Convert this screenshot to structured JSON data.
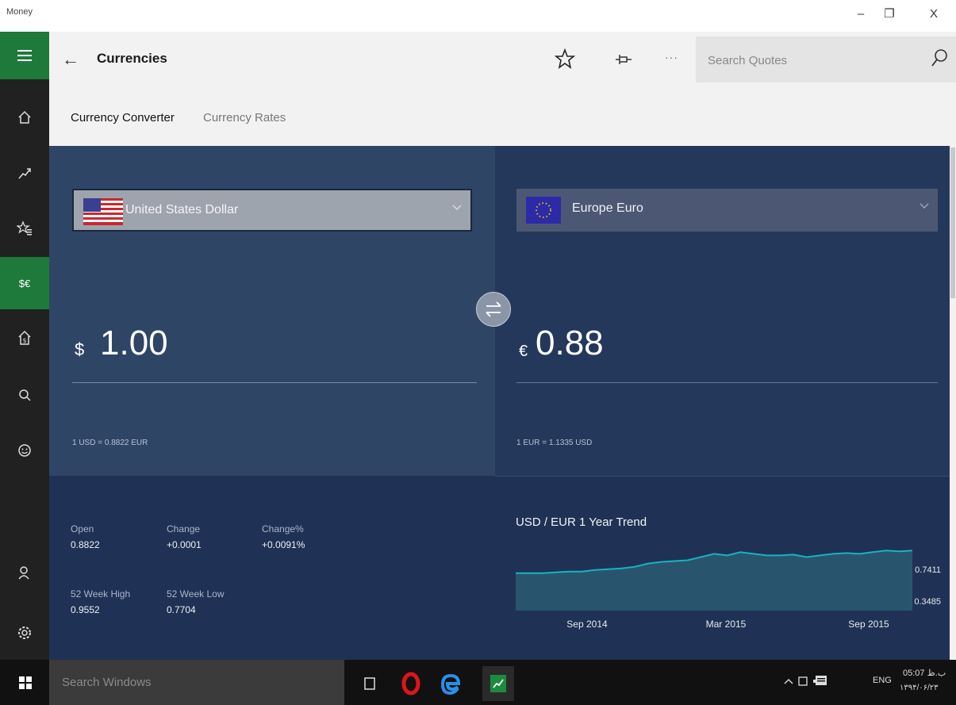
{
  "window": {
    "app_title": "Money",
    "minimize_glyph": "–",
    "maximize_glyph": "❐",
    "close_glyph": "X"
  },
  "nav": {
    "items": [
      {
        "name": "menu-icon",
        "active": true
      },
      {
        "name": "home-icon"
      },
      {
        "name": "market-trend-icon"
      },
      {
        "name": "watchlist-icon"
      },
      {
        "name": "currency-icon",
        "label": "$€",
        "active": true
      },
      {
        "name": "mortgage-calculator-icon"
      },
      {
        "name": "world-markets-icon"
      },
      {
        "name": "news-icon"
      },
      {
        "name": "account-icon"
      },
      {
        "name": "settings-icon"
      }
    ]
  },
  "header": {
    "back_glyph": "←",
    "title": "Currencies",
    "more_glyph": "···",
    "search_placeholder": "Search Quotes"
  },
  "tabs": [
    {
      "label": "Currency Converter",
      "active": true
    },
    {
      "label": "Currency Rates",
      "active": false
    }
  ],
  "converter": {
    "from": {
      "currency": "United States Dollar",
      "symbol": "$",
      "amount": "1.00",
      "rate": "1 USD = 0.8822 EUR"
    },
    "to": {
      "currency": "Europe Euro",
      "symbol": "€",
      "amount": "0.88",
      "rate": "1 EUR = 1.1335 USD"
    }
  },
  "stats": {
    "open": {
      "label": "Open",
      "value": "0.8822"
    },
    "change": {
      "label": "Change",
      "value": "+0.0001"
    },
    "change_pct": {
      "label": "Change%",
      "value": "+0.0091%"
    },
    "week52_high": {
      "label": "52 Week High",
      "value": "0.9552"
    },
    "week52_low": {
      "label": "52 Week Low",
      "value": "0.7704"
    }
  },
  "chart_data": {
    "type": "area",
    "title": "USD / EUR  1 Year Trend",
    "x_tick_labels": [
      "Sep 2014",
      "Mar 2015",
      "Sep 2015"
    ],
    "y_tick_labels": [
      "0.7411",
      "0.3485"
    ],
    "values": [
      0.58,
      0.58,
      0.58,
      0.585,
      0.59,
      0.59,
      0.6,
      0.605,
      0.61,
      0.62,
      0.64,
      0.65,
      0.655,
      0.66,
      0.68,
      0.7,
      0.69,
      0.71,
      0.7,
      0.69,
      0.69,
      0.695,
      0.68,
      0.69,
      0.7,
      0.705,
      0.7,
      0.71,
      0.72,
      0.715,
      0.72
    ],
    "ylim": [
      0.3485,
      0.7411
    ],
    "colors": {
      "line": "#17b3c0",
      "fill": "#2b5a73"
    }
  },
  "taskbar": {
    "search_placeholder": "Search Windows",
    "tray_text": "ENG",
    "clock_time": "05:07 ب.ظ",
    "clock_date": "۱۳۹۴/۰۶/۲۳"
  }
}
